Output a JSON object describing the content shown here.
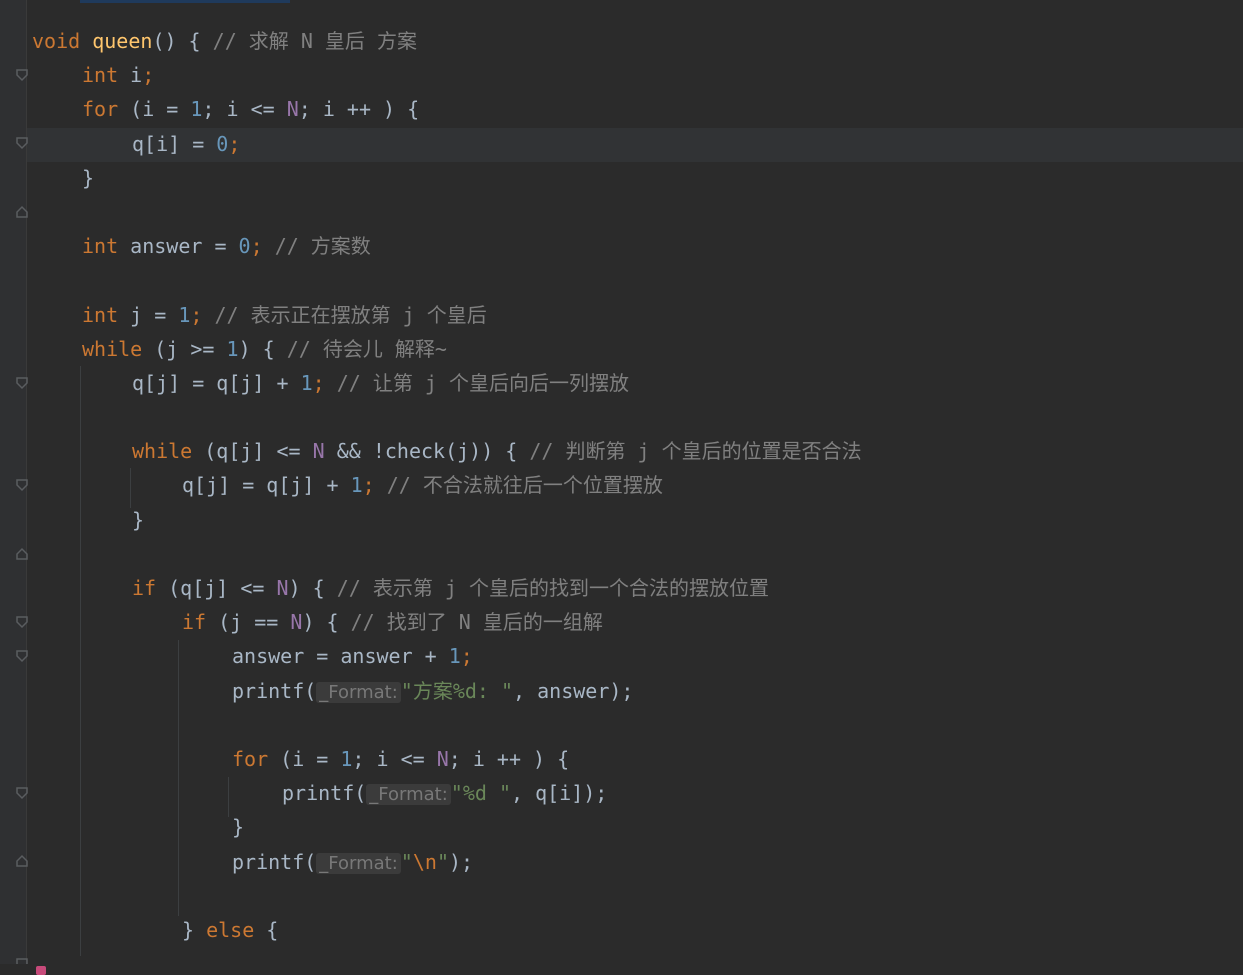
{
  "editor": {
    "language": "c",
    "theme_colors": {
      "background": "#2b2b2b",
      "keyword": "#cc7832",
      "function": "#ffc66d",
      "number": "#6897bb",
      "comment": "#808080",
      "string": "#6a8759",
      "macro": "#9876aa"
    },
    "code_lines": {
      "l1": {
        "t1": "void",
        "t2": "queen",
        "t3": "() { ",
        "t4": "// 求解 N 皇后 方案"
      },
      "l2": {
        "t1": "int",
        "t2": " i",
        "t3": ";"
      },
      "l3": {
        "t1": "for",
        "t2": " (i = ",
        "t3": "1",
        "t4": "; i <= ",
        "t5": "N",
        "t6": "; i ++ ) {"
      },
      "l4": {
        "t1": "q[i] = ",
        "t2": "0",
        "t3": ";"
      },
      "l5": {
        "t1": "}"
      },
      "l7": {
        "t1": "int",
        "t2": " answer = ",
        "t3": "0",
        "t4": "; ",
        "t5": "// 方案数"
      },
      "l9": {
        "t1": "int",
        "t2": " j = ",
        "t3": "1",
        "t4": "; ",
        "t5": "// 表示正在摆放第 j 个皇后"
      },
      "l10": {
        "t1": "while",
        "t2": " (j >= ",
        "t3": "1",
        "t4": ") { ",
        "t5": "// 待会儿 解释~"
      },
      "l11": {
        "t1": "q[j] = q[j] + ",
        "t2": "1",
        "t3": "; ",
        "t4": "// 让第 j 个皇后向后一列摆放"
      },
      "l13": {
        "t1": "while",
        "t2": " (q[j] <= ",
        "t3": "N",
        "t4": " && !check(j)) { ",
        "t5": "// 判断第 j 个皇后的位置是否合法"
      },
      "l14": {
        "t1": "q[j] = q[j] + ",
        "t2": "1",
        "t3": "; ",
        "t4": "// 不合法就往后一个位置摆放"
      },
      "l15": {
        "t1": "}"
      },
      "l17": {
        "t1": "if",
        "t2": " (q[j] <= ",
        "t3": "N",
        "t4": ") { ",
        "t5": "// 表示第 j 个皇后的找到一个合法的摆放位置"
      },
      "l18": {
        "t1": "if",
        "t2": " (j == ",
        "t3": "N",
        "t4": ") { ",
        "t5": "// 找到了 N 皇后的一组解"
      },
      "l19": {
        "t1": "answer = answer + ",
        "t2": "1",
        "t3": ";"
      },
      "l20": {
        "t1": "printf(",
        "hint": "_Format:",
        "t2": "\"方案%d: \"",
        "t3": ", answer);"
      },
      "l22": {
        "t1": "for",
        "t2": " (i = ",
        "t3": "1",
        "t4": "; i <= ",
        "t5": "N",
        "t6": "; i ++ ) {"
      },
      "l23": {
        "t1": "printf(",
        "hint": "_Format:",
        "t2": "\"%d \"",
        "t3": ", q[i]);"
      },
      "l24": {
        "t1": "}"
      },
      "l25": {
        "t1": "printf(",
        "hint": "_Format:",
        "t2": "\"",
        "t3": "\\n",
        "t4": "\"",
        "t5": ");"
      },
      "l27": {
        "t1": "} ",
        "t2": "else",
        "t3": " {"
      }
    },
    "fold_icons": [
      "fold-open-icon",
      "fold-close-icon"
    ]
  }
}
